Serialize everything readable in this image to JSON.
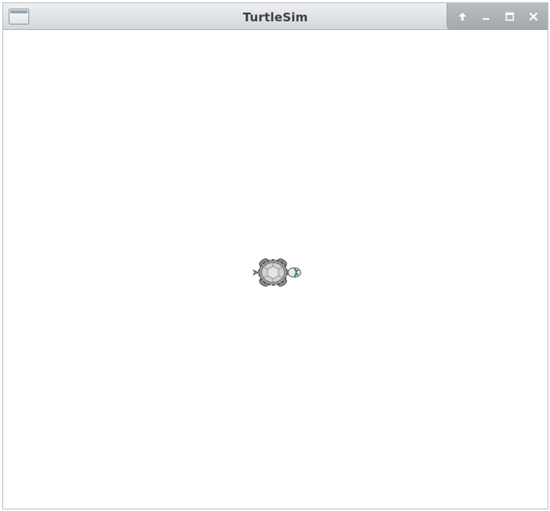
{
  "window": {
    "title": "TurtleSim",
    "background_color": "#ffffff",
    "controls": [
      {
        "name": "shade-button",
        "icon": "arrow-up-icon"
      },
      {
        "name": "minimize-button",
        "icon": "minimize-icon"
      },
      {
        "name": "maximize-button",
        "icon": "maximize-icon"
      },
      {
        "name": "close-button",
        "icon": "close-icon"
      }
    ]
  },
  "canvas": {
    "turtle": {
      "icon": "turtle-icon",
      "heading": "east"
    }
  }
}
